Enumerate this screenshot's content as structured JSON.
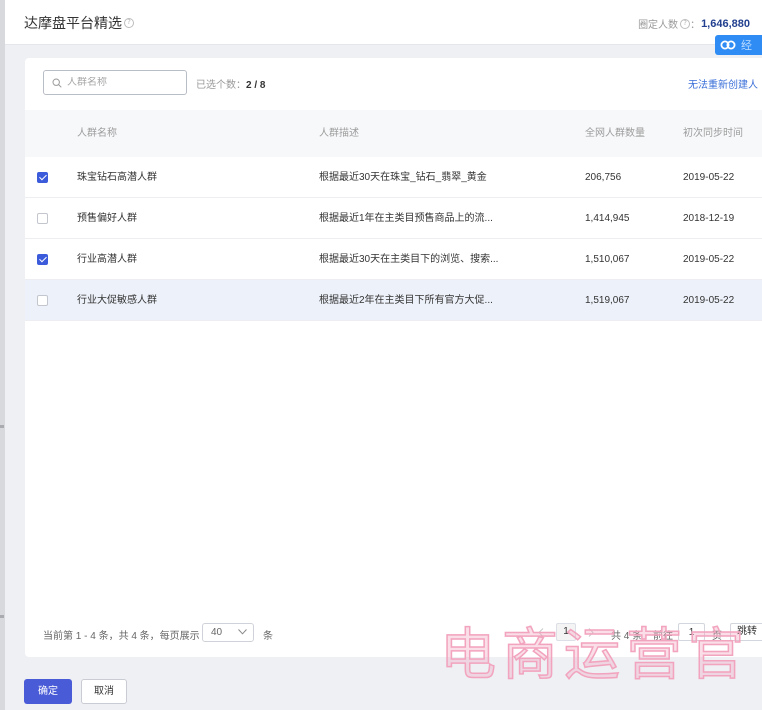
{
  "colors": {
    "primary": "#4a5bd8",
    "checkbox_checked": "#3b5bdb",
    "link": "#3a6fd8",
    "badge": "#2f8cf4",
    "audience_value": "#22408f",
    "row_hover": "#edf1f9",
    "watermark": "#f2a3bd"
  },
  "dialog": {
    "title": "达摩盘平台精选",
    "audience_label": "圈定人数",
    "audience_sep": "：",
    "audience_value": "1,646,880",
    "badge_icon": "cloud-link-icon",
    "badge_text": "经"
  },
  "toolbar": {
    "search_icon": "search-icon",
    "search_placeholder": "人群名称",
    "picked_label": "已选个数：",
    "picked_value": "2 / 8",
    "link_text": "无法重新创建人"
  },
  "table": {
    "columns": {
      "name": "人群名称",
      "desc": "人群描述",
      "count": "全网人群数量",
      "date": "初次同步时间"
    },
    "rows": [
      {
        "checked": true,
        "name": "珠宝钻石高潜人群",
        "desc": "根据最近30天在珠宝_钻石_翡翠_黄金",
        "count": "206,756",
        "date": "2019-05-22"
      },
      {
        "checked": false,
        "name": "预售偏好人群",
        "desc": "根据最近1年在主类目预售商品上的流...",
        "count": "1,414,945",
        "date": "2018-12-19"
      },
      {
        "checked": true,
        "name": "行业高潜人群",
        "desc": "根据最近30天在主类目下的浏览、搜索...",
        "count": "1,510,067",
        "date": "2019-05-22"
      },
      {
        "checked": false,
        "name": "行业大促敏感人群",
        "desc": "根据最近2年在主类目下所有官方大促...",
        "count": "1,519,067",
        "date": "2019-05-22"
      }
    ]
  },
  "pagination": {
    "summary": "当前第 1 - 4 条，共 4 条，每页展示",
    "page_size": "40",
    "page_size_unit": "条",
    "current_page": "1",
    "total": "共 4 条",
    "goto_label": "前往",
    "goto_value": "1",
    "page_unit": "页",
    "jump_label": "跳转"
  },
  "actions": {
    "confirm": "确定",
    "cancel": "取消"
  },
  "watermark": "电商运营官"
}
